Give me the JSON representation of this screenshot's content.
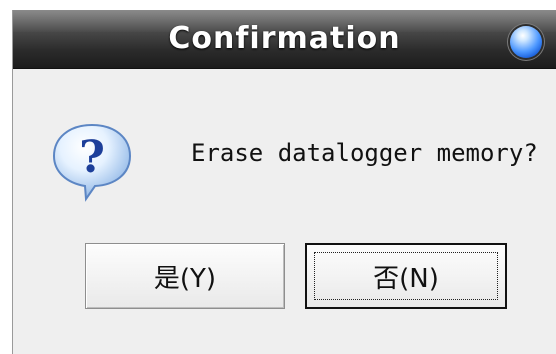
{
  "dialog": {
    "title": "Confirmation",
    "message": "Erase datalogger memory?",
    "icon": "question-icon",
    "buttons": {
      "yes_label": "是(Y)",
      "no_label": "否(N)"
    }
  },
  "colors": {
    "titlebar": "#2b2b2b",
    "dialog_bg": "#efefef",
    "close_orb": "#4c97ff"
  }
}
